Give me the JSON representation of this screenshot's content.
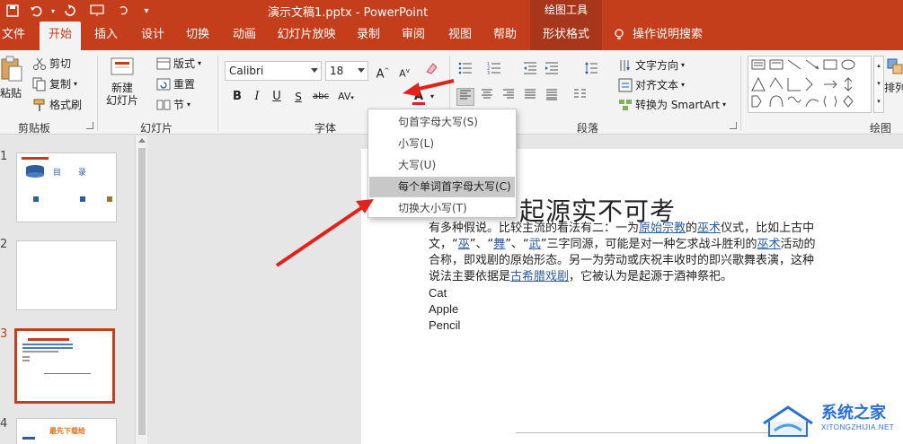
{
  "title_bar": {
    "doc_title": "演示文稿1.pptx  -  PowerPoint",
    "context_tools": "绘图工具"
  },
  "tabs": [
    {
      "label": "文件"
    },
    {
      "label": "开始"
    },
    {
      "label": "插入"
    },
    {
      "label": "设计"
    },
    {
      "label": "切换"
    },
    {
      "label": "动画"
    },
    {
      "label": "幻灯片放映"
    },
    {
      "label": "录制"
    },
    {
      "label": "审阅"
    },
    {
      "label": "视图"
    },
    {
      "label": "帮助"
    },
    {
      "label": "形状格式"
    },
    {
      "label": "操作说明搜索"
    }
  ],
  "ribbon": {
    "clipboard": {
      "paste": "粘贴",
      "cut": "剪切",
      "copy": "复制",
      "format_painter": "格式刷",
      "label": "剪贴板"
    },
    "slides": {
      "new_slide": "新建\n幻灯片",
      "layout": "版式",
      "reset": "重置",
      "section": "节",
      "label": "幻灯片"
    },
    "font": {
      "name": "Calibri",
      "size": "18",
      "label": "字体",
      "case_button": "Aa"
    },
    "paragraph": {
      "text_direction": "文字方向",
      "align_text": "对齐文本",
      "smartart": "转换为 SmartArt",
      "label": "段落"
    },
    "drawing": {
      "arrange": "排列",
      "label": "绘图"
    }
  },
  "case_menu": {
    "items": [
      {
        "label": "句首字母大写(S)"
      },
      {
        "label": "小写(L)"
      },
      {
        "label": "大写(U)"
      },
      {
        "label": "每个单词首字母大写(C)"
      },
      {
        "label": "切换大小写(T)"
      }
    ]
  },
  "slides_panel": {
    "slides": [
      {
        "number": "1",
        "heading": "目  录"
      },
      {
        "number": "2"
      },
      {
        "number": "3"
      },
      {
        "number": "4",
        "heading": "最先下载给"
      }
    ]
  },
  "slide": {
    "title": "起源实不可考",
    "p1": "有多种假说。比较主流的看法有二：一为",
    "link1": "原始宗教",
    "p2": "的",
    "link2": "巫术",
    "p3": "仪式，比如上古中文，“",
    "link3": "巫",
    "p4": "”、“",
    "link4": "舞",
    "p5": "”、“",
    "link5": "武",
    "p6": "”三字同源，可能是对一种乞求战斗胜利的",
    "link6": "巫术",
    "p7": "活动的合称，即戏剧的原始形态。另一为劳动或庆祝丰收时的即兴歌舞表演，这种说法主要依据是",
    "link7": "古希腊戏剧",
    "p8": "，它被认为是起源于酒神祭祀。",
    "lines": [
      "Cat",
      "Apple",
      "Pencil"
    ]
  },
  "watermark": {
    "title": "系统之家",
    "subtitle": "XITONGZHIJIA.NET"
  },
  "colors": {
    "accent": "#c43e1c",
    "link": "#2e5d9f",
    "arrow": "#e0221c"
  }
}
